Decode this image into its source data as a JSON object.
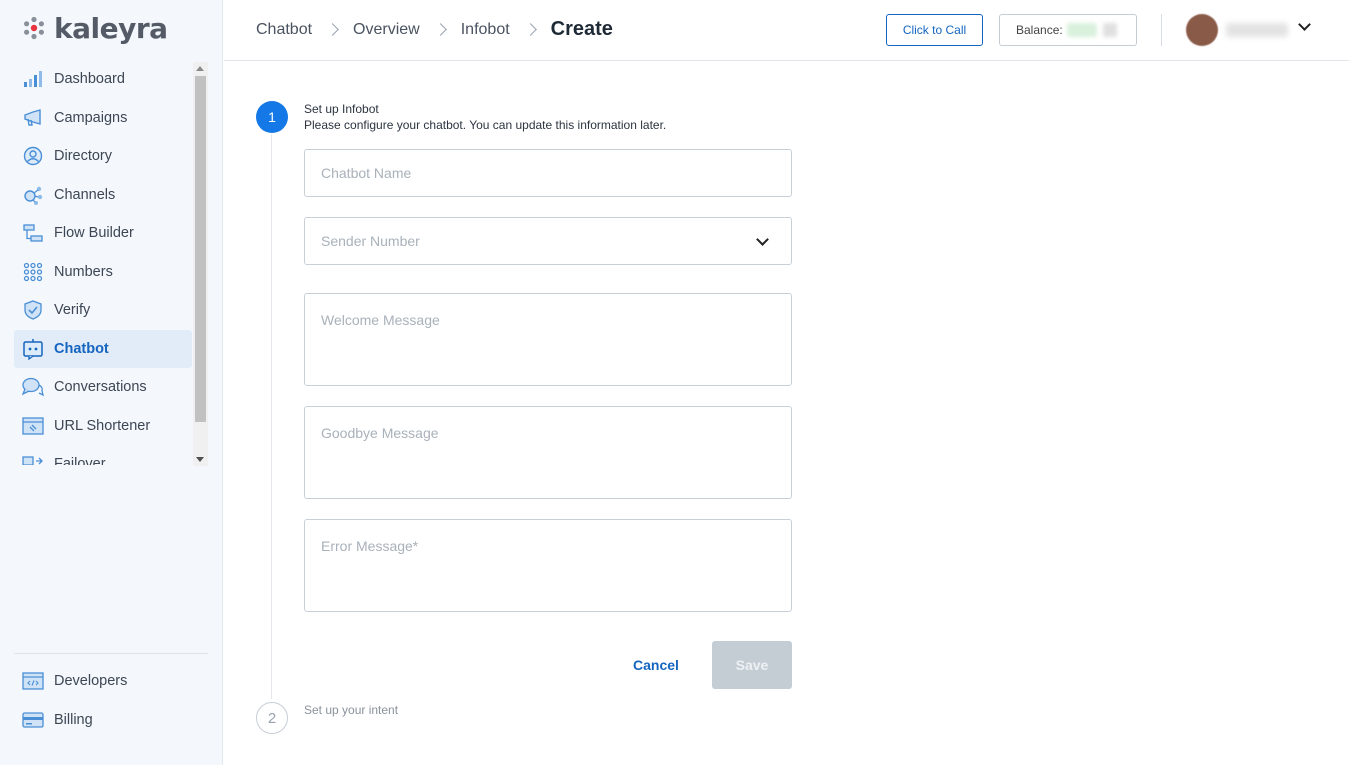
{
  "brand": {
    "name": "kaleyra",
    "logo_color": "#e8343e"
  },
  "sidebar": {
    "items": [
      {
        "label": "Dashboard",
        "icon": "dashboard-icon"
      },
      {
        "label": "Campaigns",
        "icon": "megaphone-icon"
      },
      {
        "label": "Directory",
        "icon": "directory-icon"
      },
      {
        "label": "Channels",
        "icon": "channels-icon"
      },
      {
        "label": "Flow Builder",
        "icon": "flow-builder-icon"
      },
      {
        "label": "Numbers",
        "icon": "numbers-grid-icon"
      },
      {
        "label": "Verify",
        "icon": "shield-check-icon"
      },
      {
        "label": "Chatbot",
        "icon": "chatbot-icon",
        "active": true
      },
      {
        "label": "Conversations",
        "icon": "chat-bubbles-icon"
      },
      {
        "label": "URL Shortener",
        "icon": "link-icon"
      },
      {
        "label": "Failover",
        "icon": "failover-icon"
      }
    ],
    "bottom_items": [
      {
        "label": "Developers",
        "icon": "code-icon"
      },
      {
        "label": "Billing",
        "icon": "credit-card-icon"
      }
    ]
  },
  "header": {
    "breadcrumbs": [
      "Chatbot",
      "Overview",
      "Infobot",
      "Create"
    ],
    "click_to_call_label": "Click to Call",
    "balance_label": "Balance:"
  },
  "step1": {
    "number": "1",
    "title": "Set up Infobot",
    "subtitle": "Please configure your chatbot. You can update this information later."
  },
  "form": {
    "chatbot_name_placeholder": "Chatbot Name",
    "sender_number_placeholder": "Sender Number",
    "welcome_placeholder": "Welcome Message",
    "goodbye_placeholder": "Goodbye Message",
    "error_placeholder": "Error Message*",
    "cancel_label": "Cancel",
    "save_label": "Save"
  },
  "step2": {
    "number": "2",
    "title": "Set up your intent"
  },
  "colors": {
    "accent": "#1565c0",
    "step_active": "#1478e6",
    "active_nav_bg": "#e1ecf8",
    "disabled_button": "#c4ccd4"
  }
}
